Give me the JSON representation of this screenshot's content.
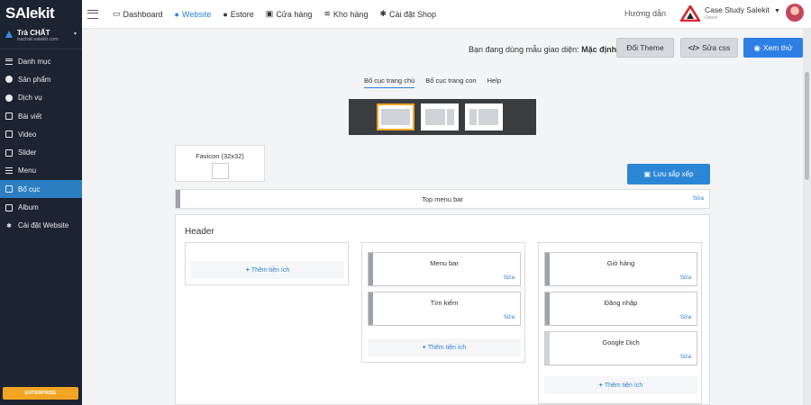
{
  "app": {
    "logo": "SAlekit",
    "shop_name": "Trà CHẤT",
    "shop_url": "trachat.salekit.com",
    "plan_label": "ENTERPRISE"
  },
  "sidebar": {
    "items": [
      {
        "label": "Danh mục",
        "icon": "list-icon"
      },
      {
        "label": "Sản phẩm",
        "icon": "product-icon"
      },
      {
        "label": "Dịch vụ",
        "icon": "service-icon"
      },
      {
        "label": "Bài viết",
        "icon": "article-icon"
      },
      {
        "label": "Video",
        "icon": "video-icon"
      },
      {
        "label": "Slider",
        "icon": "slider-icon"
      },
      {
        "label": "Menu",
        "icon": "menu-icon"
      },
      {
        "label": "Bố cục",
        "icon": "layout-icon",
        "active": true
      },
      {
        "label": "Album",
        "icon": "album-icon"
      },
      {
        "label": "Cài đặt Website",
        "icon": "settings-icon"
      }
    ]
  },
  "topnav": {
    "items": [
      {
        "label": "Dashboard",
        "icon": "monitor-icon"
      },
      {
        "label": "Website",
        "icon": "globe-icon",
        "active": true
      },
      {
        "label": "Estore",
        "icon": "globe-icon"
      },
      {
        "label": "Cửa hàng",
        "icon": "store-icon"
      },
      {
        "label": "Kho hàng",
        "icon": "stack-icon"
      },
      {
        "label": "Cài đặt Shop",
        "icon": "gear-icon"
      }
    ],
    "guide": "Hướng dẫn",
    "user_name": "Case Study Salekit",
    "user_role": "Owner"
  },
  "theme": {
    "prefix": "Bạn đang dùng mẫu giao diện:",
    "current": "Mặc định",
    "change_theme": "Đổi Theme",
    "edit_css": "Sửa css",
    "preview": "Xem thử"
  },
  "tabs": [
    {
      "label": "Bố cục trang chủ",
      "active": true
    },
    {
      "label": "Bố cục trang con"
    },
    {
      "label": "Help"
    }
  ],
  "favicon_label": "Favicon (32x32)",
  "save_label": "Lưu sắp xếp",
  "top_menu_bar": {
    "title": "Top menu bar",
    "edit": "Sửa"
  },
  "header": {
    "title": "Header",
    "add_widget": "Thêm tiện ích",
    "col2_widgets": [
      {
        "title": "Menu bar",
        "edit": "Sửa"
      },
      {
        "title": "Tìm kiếm",
        "edit": "Sửa"
      }
    ],
    "col3_widgets": [
      {
        "title": "Giỏ hàng",
        "edit": "Sửa"
      },
      {
        "title": "Đăng nhập",
        "edit": "Sửa"
      },
      {
        "title": "Google Dịch",
        "edit": "Sửa"
      }
    ]
  },
  "colors": {
    "sidebar_bg": "#1c2331",
    "active_blue": "#2b7ec2",
    "primary_button": "#2d7fe6",
    "plan_badge": "#f4a523",
    "selected_layout": "#f5a623"
  }
}
